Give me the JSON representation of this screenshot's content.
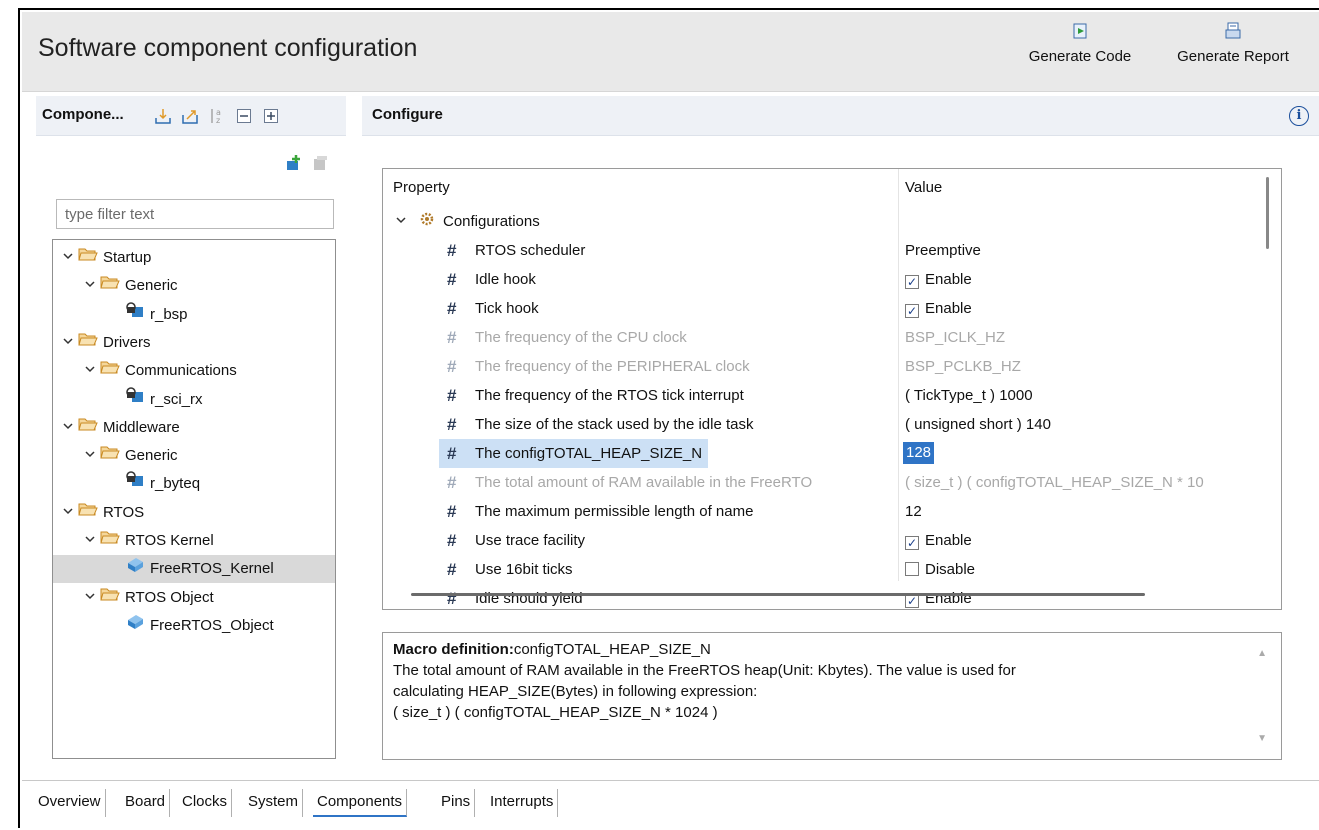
{
  "header": {
    "title": "Software component configuration",
    "generate_code": "Generate Code",
    "generate_report": "Generate Report"
  },
  "components": {
    "title": "Compone...",
    "filter_placeholder": "type filter text",
    "tree": [
      {
        "label": "Startup",
        "level": 0,
        "type": "folder"
      },
      {
        "label": "Generic",
        "level": 1,
        "type": "folder"
      },
      {
        "label": "r_bsp",
        "level": 2,
        "type": "module"
      },
      {
        "label": "Drivers",
        "level": 0,
        "type": "folder"
      },
      {
        "label": "Communications",
        "level": 1,
        "type": "folder"
      },
      {
        "label": "r_sci_rx",
        "level": 2,
        "type": "module"
      },
      {
        "label": "Middleware",
        "level": 0,
        "type": "folder"
      },
      {
        "label": "Generic",
        "level": 1,
        "type": "folder"
      },
      {
        "label": "r_byteq",
        "level": 2,
        "type": "module"
      },
      {
        "label": "RTOS",
        "level": 0,
        "type": "folder"
      },
      {
        "label": "RTOS Kernel",
        "level": 1,
        "type": "folder"
      },
      {
        "label": "FreeRTOS_Kernel",
        "level": 2,
        "type": "rtos",
        "selected": true
      },
      {
        "label": "RTOS Object",
        "level": 1,
        "type": "folder"
      },
      {
        "label": "FreeRTOS_Object",
        "level": 2,
        "type": "rtos"
      }
    ]
  },
  "configure": {
    "title": "Configure",
    "col_property": "Property",
    "col_value": "Value",
    "group_label": "Configurations",
    "rows": [
      {
        "property": "RTOS scheduler",
        "value": "Preemptive"
      },
      {
        "property": "Idle hook",
        "value": "Enable",
        "checkbox": "checked"
      },
      {
        "property": "Tick hook",
        "value": "Enable",
        "checkbox": "checked"
      },
      {
        "property": "The frequency of the CPU clock",
        "value": "BSP_ICLK_HZ",
        "disabled": true
      },
      {
        "property": "The frequency of the PERIPHERAL clock",
        "value": "BSP_PCLKB_HZ",
        "disabled": true
      },
      {
        "property": "The frequency of the RTOS tick interrupt",
        "value": "( TickType_t ) 1000"
      },
      {
        "property": "The size of the stack used by the idle task",
        "value": "( unsigned short ) 140"
      },
      {
        "property": "The configTOTAL_HEAP_SIZE_N",
        "value": "128",
        "selected": true
      },
      {
        "property": "The total amount of RAM available in the FreeRTO",
        "value": "( size_t ) ( configTOTAL_HEAP_SIZE_N * 10",
        "disabled": true
      },
      {
        "property": "The maximum permissible length of name",
        "value": "12"
      },
      {
        "property": "Use trace facility",
        "value": "Enable",
        "checkbox": "checked"
      },
      {
        "property": "Use 16bit ticks",
        "value": "Disable",
        "checkbox": "unchecked"
      },
      {
        "property": "Idle should yield",
        "value": "Enable",
        "checkbox": "checked"
      }
    ]
  },
  "description": {
    "macro_label": "Macro definition:",
    "macro_name": "configTOTAL_HEAP_SIZE_N",
    "line1": "The total amount of RAM available in the FreeRTOS heap(Unit: Kbytes). The value is used for",
    "line2": "calculating HEAP_SIZE(Bytes) in following expression:",
    "line3": "( size_t ) ( configTOTAL_HEAP_SIZE_N * 1024 )"
  },
  "tabs": [
    "Overview",
    "Board",
    "Clocks",
    "System",
    "Components",
    "Pins",
    "Interrupts"
  ],
  "active_tab": "Components",
  "colors": {
    "selection_blue": "#2f74c6",
    "selection_light": "#cce0f5",
    "folder_orange": "#e8a23a",
    "panel_header": "#eef1f6"
  }
}
